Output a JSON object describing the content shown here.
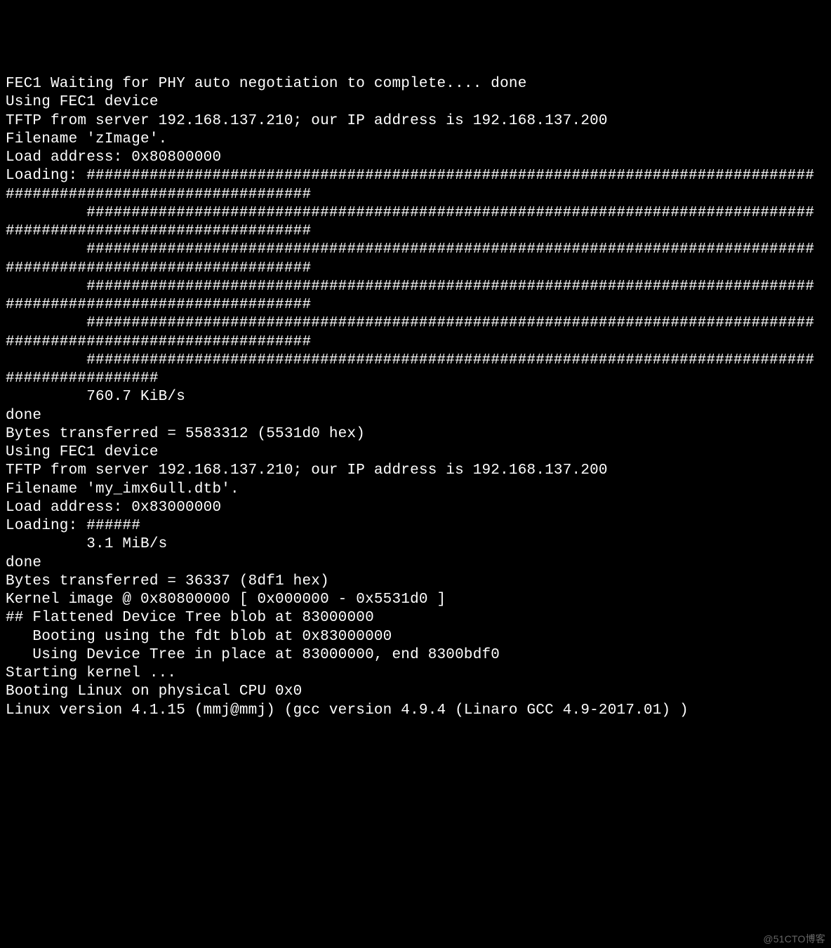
{
  "lines": [
    "FEC1 Waiting for PHY auto negotiation to complete.... done",
    "Using FEC1 device",
    "TFTP from server 192.168.137.210; our IP address is 192.168.137.200",
    "Filename 'zImage'.",
    "Load address: 0x80800000",
    "Loading: #################################################################################",
    "##################################",
    "",
    "         #################################################################################",
    "##################################",
    "",
    "         #################################################################################",
    "##################################",
    "",
    "         #################################################################################",
    "##################################",
    "",
    "         #################################################################################",
    "##################################",
    "",
    "         #################################################################################",
    "#################",
    "         760.7 KiB/s",
    "done",
    "Bytes transferred = 5583312 (5531d0 hex)",
    "Using FEC1 device",
    "TFTP from server 192.168.137.210; our IP address is 192.168.137.200",
    "Filename 'my_imx6ull.dtb'.",
    "Load address: 0x83000000",
    "Loading: ######",
    "         3.1 MiB/s",
    "done",
    "Bytes transferred = 36337 (8df1 hex)",
    "Kernel image @ 0x80800000 [ 0x000000 - 0x5531d0 ]",
    "## Flattened Device Tree blob at 83000000",
    "   Booting using the fdt blob at 0x83000000",
    "   Using Device Tree in place at 83000000, end 8300bdf0",
    "",
    "Starting kernel ...",
    "",
    "Booting Linux on physical CPU 0x0",
    "Linux version 4.1.15 (mmj@mmj) (gcc version 4.9.4 (Linaro GCC 4.9-2017.01) )"
  ],
  "watermark": "@51CTO博客"
}
